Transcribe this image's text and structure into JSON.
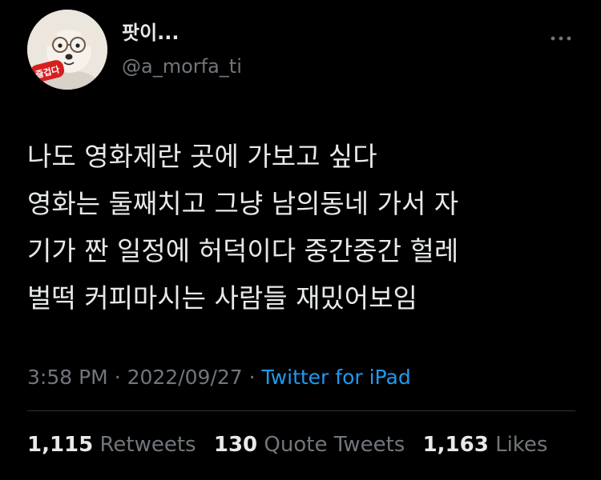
{
  "author": {
    "display_name": "팟이...",
    "handle": "@a_morfa_ti",
    "avatar_badge_text": "즐겁다"
  },
  "tweet": {
    "lines": [
      "나도 영화제란 곳에 가보고 싶다",
      "영화는 둘째치고 그냥 남의동네 가서 자",
      "기가 짠 일정에 허덕이다 중간중간 헐레",
      "벌떡 커피마시는 사람들 재밌어보임"
    ]
  },
  "meta": {
    "time": "3:58 PM",
    "separator": "·",
    "date": "2022/09/27",
    "source": "Twitter for iPad"
  },
  "stats": {
    "retweets_count": "1,115",
    "retweets_label": "Retweets",
    "quotes_count": "130",
    "quotes_label": "Quote Tweets",
    "likes_count": "1,163",
    "likes_label": "Likes"
  },
  "icons": {
    "more": "more-horizontal-icon"
  },
  "colors": {
    "background": "#000000",
    "primary_text": "#e7e9ea",
    "secondary_text": "#71767b",
    "link": "#1d9bf0",
    "badge": "#d62020"
  }
}
